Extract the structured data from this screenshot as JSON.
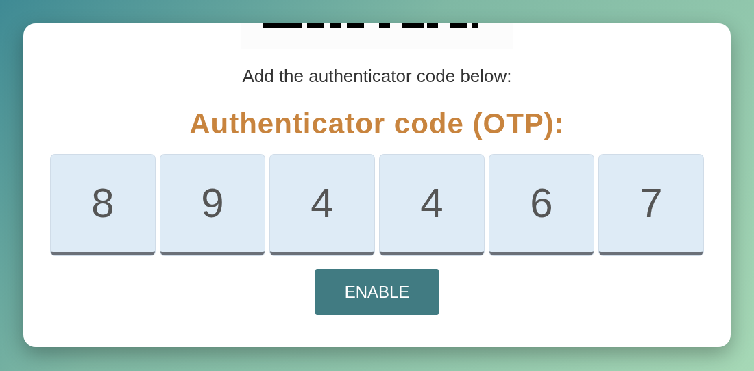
{
  "instruction": "Add the authenticator code below:",
  "heading": "Authenticator code (OTP):",
  "otp_digits": [
    "8",
    "9",
    "4",
    "4",
    "6",
    "7"
  ],
  "button": "ENABLE"
}
